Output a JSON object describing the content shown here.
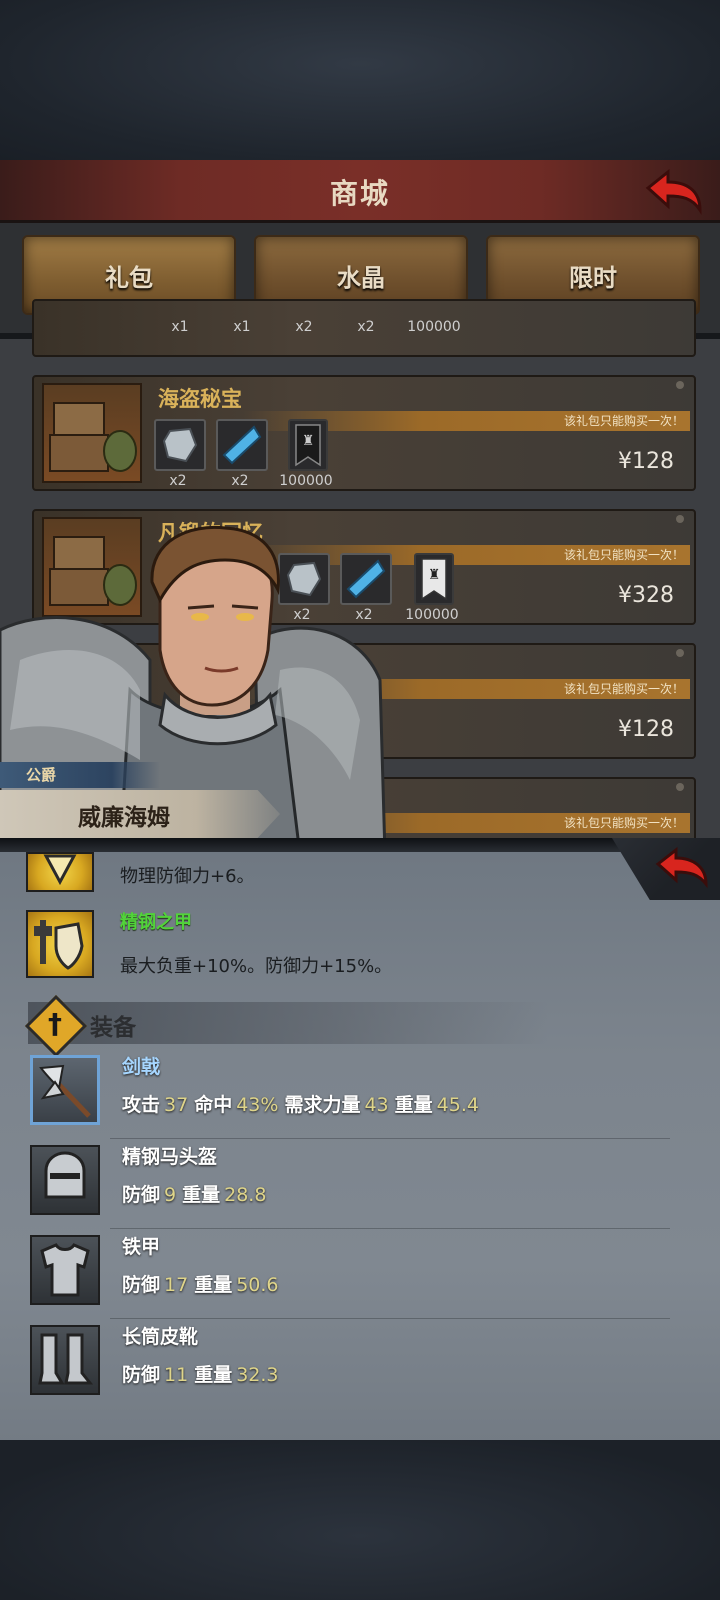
{
  "shop": {
    "title": "商城",
    "tabs": [
      "礼包",
      "水晶",
      "限时"
    ],
    "partial_row": {
      "counts": [
        "x1",
        "x1",
        "x2",
        "x2",
        "100000"
      ]
    },
    "packs": [
      {
        "name": "海盗秘宝",
        "notice": "该礼包只能购买一次！",
        "counts": [
          "x2",
          "x2",
          "100000"
        ],
        "price": "¥128"
      },
      {
        "name": "凡锻的回忆",
        "notice": "该礼包只能购买一次！",
        "counts": [
          "x2",
          "x2",
          "100000"
        ],
        "price": "¥328"
      },
      {
        "name": "",
        "notice": "该礼包只能购买一次！",
        "counts": [],
        "price": "¥128"
      },
      {
        "name": "",
        "notice": "该礼包只能购买一次！",
        "counts": [],
        "price": ""
      }
    ]
  },
  "character": {
    "title": "公爵",
    "name": "威廉海姆"
  },
  "skills": [
    {
      "name": "",
      "desc": "物理防御力+6。"
    },
    {
      "name": "精钢之甲",
      "desc": "最大负重+10%。防御力+15%。"
    }
  ],
  "equipment": {
    "section_label": "装备",
    "items": [
      {
        "name": "剑戟",
        "stats": [
          [
            "攻击",
            "37"
          ],
          [
            "命中",
            "43%"
          ],
          [
            "需求力量",
            "43"
          ],
          [
            "重量",
            "45.4"
          ]
        ],
        "icon": "halberd-icon"
      },
      {
        "name": "精钢马头盔",
        "stats": [
          [
            "防御",
            "9"
          ],
          [
            "重量",
            "28.8"
          ]
        ],
        "icon": "helmet-icon"
      },
      {
        "name": "铁甲",
        "stats": [
          [
            "防御",
            "17"
          ],
          [
            "重量",
            "50.6"
          ]
        ],
        "icon": "armor-icon"
      },
      {
        "name": "长筒皮靴",
        "stats": [
          [
            "防御",
            "11"
          ],
          [
            "重量",
            "32.3"
          ]
        ],
        "icon": "boots-icon"
      }
    ]
  },
  "colors": {
    "header_red": "#7a2f28",
    "tab_gold": "#8c6a3e",
    "skill_green": "#52d33a",
    "stat_value": "#dfd58a",
    "panel_gray": "#7c848d"
  }
}
